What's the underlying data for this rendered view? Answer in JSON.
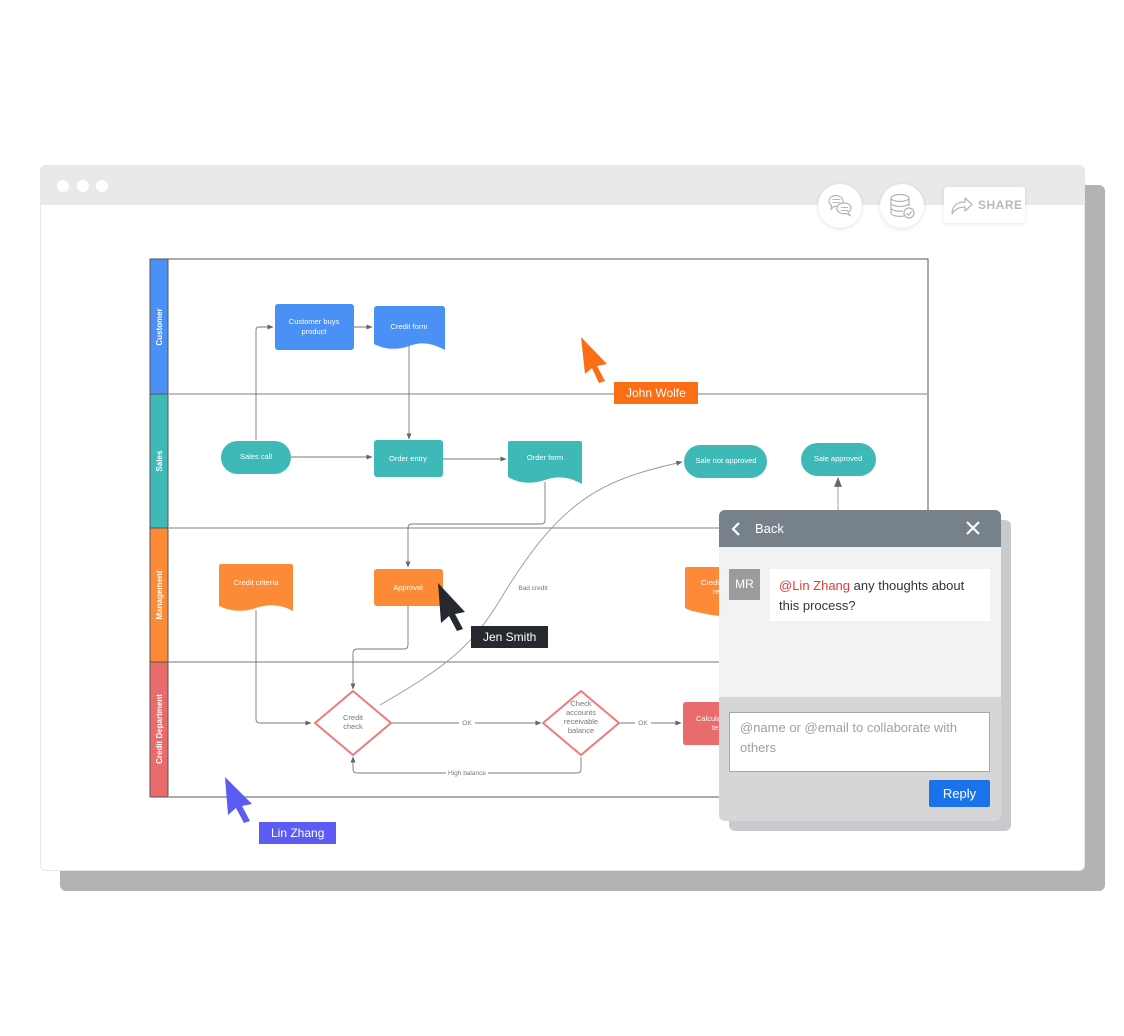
{
  "window": {
    "toolbar": {
      "comments_icon": "chat-bubbles-icon",
      "data_icon": "database-check-icon",
      "share_icon": "share-arrow-icon",
      "share_label": "SHARE"
    }
  },
  "diagram": {
    "lanes": [
      {
        "label": "Customer",
        "color": "#4a90f5"
      },
      {
        "label": "Sales",
        "color": "#3fb8b8"
      },
      {
        "label": "Management",
        "color": "#fc8a36"
      },
      {
        "label": "Credit Department",
        "color": "#ea6b6b"
      }
    ],
    "shapes": {
      "customer_buys": "Customer buys product",
      "credit_form": "Credit form",
      "sales_call": "Sales call",
      "order_entry": "Order entry",
      "order_form": "Order form",
      "sale_not_approved": "Sale not approved",
      "sale_approved": "Sale approved",
      "credit_criteria": "Credit criteria",
      "approval": "Approval",
      "credit_report": "Credit re",
      "credit_check": "Credit check",
      "check_ar": "Check accounts receivable balance",
      "calculate": "Calcula te"
    },
    "edge_labels": {
      "bad_credit": "Bad credit",
      "ok1": "OK",
      "ok2": "OK",
      "high_balance": "High balance"
    }
  },
  "cursors": [
    {
      "name": "John Wolfe",
      "color": "#fb6e14"
    },
    {
      "name": "Jen Smith",
      "color": "#262a30"
    },
    {
      "name": "Lin Zhang",
      "color": "#5c5cf5"
    }
  ],
  "comment_panel": {
    "back_label": "Back",
    "close_icon": "close-icon",
    "comment": {
      "avatar_initials": "MR",
      "mention": "@Lin Zhang",
      "text": " any thoughts about this process?"
    },
    "reply_placeholder": "@name or @email to collaborate with others",
    "reply_value": "",
    "reply_label": "Reply"
  }
}
